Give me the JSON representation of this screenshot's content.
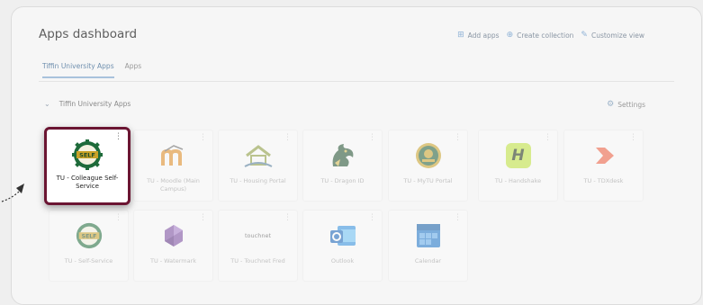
{
  "header": {
    "title": "Apps dashboard",
    "actions": [
      {
        "icon": "grid-plus-icon",
        "label": "Add apps"
      },
      {
        "icon": "plus-circle-icon",
        "label": "Create collection"
      },
      {
        "icon": "pencil-icon",
        "label": "Customize view"
      }
    ]
  },
  "tabs": [
    {
      "label": "Tiffin University Apps",
      "active": true
    },
    {
      "label": "Apps",
      "active": false
    }
  ],
  "section": {
    "title": "Tiffin University Apps",
    "settings_label": "Settings"
  },
  "apps": [
    {
      "label": "TU - Colleague Self-Service",
      "icon": "self-service-gear-logo",
      "highlighted": true
    },
    {
      "label": "TU - Moodle (Main Campus)",
      "icon": "moodle-logo"
    },
    {
      "label": "TU - Housing Portal",
      "icon": "housing-house-logo"
    },
    {
      "label": "TU - Dragon ID",
      "icon": "dragon-logo"
    },
    {
      "label": "TU - MyTU Portal",
      "icon": "mytu-seal-logo"
    },
    {
      "label": "TU - Handshake",
      "icon": "handshake-logo"
    },
    {
      "label": "TU - TDXdesk",
      "icon": "tdx-chevron-logo"
    },
    {
      "label": "TU - Self-Service",
      "icon": "self-service-gear-logo"
    },
    {
      "label": "TU - Watermark",
      "icon": "watermark-logo"
    },
    {
      "label": "TU - Touchnet Fred",
      "icon": "touchnet-logo",
      "logo_text": "touchnet"
    },
    {
      "label": "Outlook",
      "icon": "outlook-logo"
    },
    {
      "label": "Calendar",
      "icon": "calendar-logo"
    }
  ],
  "colors": {
    "highlight_border": "#6b1532",
    "accent": "#6f8fae"
  }
}
